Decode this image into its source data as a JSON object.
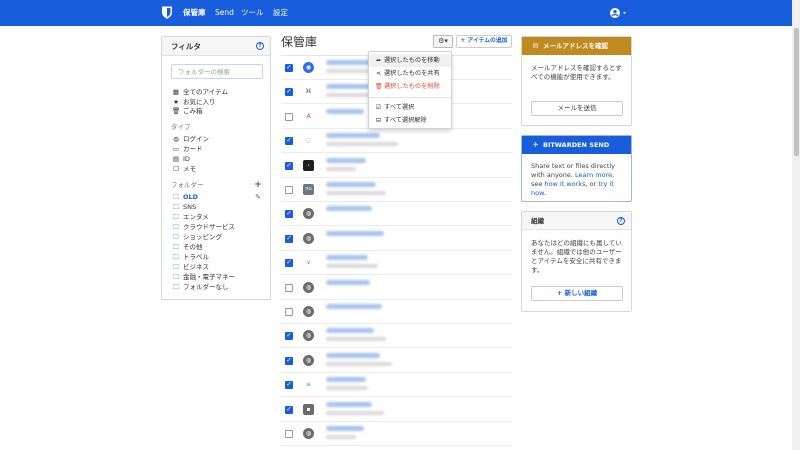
{
  "nav": {
    "items": [
      {
        "label": "保管庫",
        "active": true
      },
      {
        "label": "Send",
        "active": false
      },
      {
        "label": "ツール",
        "active": false
      },
      {
        "label": "設定",
        "active": false
      }
    ],
    "bg_color": "#175ddc"
  },
  "filters": {
    "title": "フィルタ",
    "search_placeholder": "フォルダーの検索",
    "all_items": "全てのアイテム",
    "favorites": "お気に入り",
    "trash": "ごみ箱",
    "types_header": "タイプ",
    "types": [
      {
        "icon": "globe-icon",
        "label": "ログイン"
      },
      {
        "icon": "credit-card-icon",
        "label": "カード"
      },
      {
        "icon": "id-card-icon",
        "label": "ID"
      },
      {
        "icon": "note-icon",
        "label": "メモ"
      }
    ],
    "folders_header": "フォルダー",
    "folders": [
      {
        "label": "OLD",
        "active": true
      },
      {
        "label": "SNS",
        "active": false
      },
      {
        "label": "エンタメ",
        "active": false
      },
      {
        "label": "クラウドサービス",
        "active": false
      },
      {
        "label": "ショッピング",
        "active": false
      },
      {
        "label": "その他",
        "active": false
      },
      {
        "label": "トラベル",
        "active": false
      },
      {
        "label": "ビジネス",
        "active": false
      },
      {
        "label": "金融・電子マネー",
        "active": false
      },
      {
        "label": "フォルダーなし",
        "active": false
      }
    ]
  },
  "vault": {
    "title": "保管庫",
    "add_item_label": "アイテムの追加",
    "rows": [
      {
        "checked": true,
        "icon": "blue-circle-icon",
        "icon_color": "#2f6fe0"
      },
      {
        "checked": true,
        "icon": "game-controller-icon",
        "icon_color": "#ffffff"
      },
      {
        "checked": false,
        "icon": "red-a-logo-icon",
        "icon_color": "#ffffff"
      },
      {
        "checked": true,
        "icon": "fingerprint-icon",
        "icon_color": "#ffffff"
      },
      {
        "checked": true,
        "icon": "chevron-logo-icon",
        "icon_color": "#222222"
      },
      {
        "checked": false,
        "icon": "nu-logo-icon",
        "icon_color": "#555555"
      },
      {
        "checked": true,
        "icon": "globe-icon",
        "icon_color": "#6b6b6b"
      },
      {
        "checked": true,
        "icon": "globe-icon",
        "icon_color": "#6b6b6b"
      },
      {
        "checked": true,
        "icon": "green-sprout-icon",
        "icon_color": "#ffffff"
      },
      {
        "checked": false,
        "icon": "globe-icon",
        "icon_color": "#6b6b6b"
      },
      {
        "checked": false,
        "icon": "globe-icon",
        "icon_color": "#6b6b6b"
      },
      {
        "checked": true,
        "icon": "globe-icon",
        "icon_color": "#6b6b6b"
      },
      {
        "checked": true,
        "icon": "globe-icon",
        "icon_color": "#6b6b6b"
      },
      {
        "checked": true,
        "icon": "striped-logo-icon",
        "icon_color": "#ffffff"
      },
      {
        "checked": true,
        "icon": "dark-square-icon",
        "icon_color": "#6a6a6a"
      },
      {
        "checked": false,
        "icon": "globe-icon",
        "icon_color": "#6b6b6b"
      }
    ]
  },
  "dropdown": {
    "items": [
      {
        "icon": "share-arrow-icon",
        "label": "選択したものを移動",
        "danger": false
      },
      {
        "icon": "share-icon",
        "label": "選択したものを共有",
        "danger": false
      },
      {
        "icon": "trash-icon",
        "label": "選択したものを削除",
        "danger": true
      },
      {
        "icon": "check-square-icon",
        "label": "すべて選択",
        "danger": false
      },
      {
        "icon": "minus-square-icon",
        "label": "すべて選択解除",
        "danger": false
      }
    ]
  },
  "verify_email": {
    "title": "メールアドレスを確認",
    "body": "メールアドレスを確認するとすべての機能が使用できます。",
    "button": "メールを送信",
    "head_color": "#c08a20"
  },
  "send_card": {
    "title": "BITWARDEN SEND",
    "body_1": "Share text or files directly with anyone. ",
    "link_1": "Learn more",
    "body_2": ", see ",
    "link_2": "how it works",
    "body_3": ", or ",
    "link_3": "try it now",
    "body_4": ".",
    "head_color": "#175ddc"
  },
  "org_card": {
    "title": "組織",
    "body": "あなたはどの組織にも属していません。組織では他のユーザーとアイテムを安全に共有できます。",
    "button": "新しい組織"
  }
}
